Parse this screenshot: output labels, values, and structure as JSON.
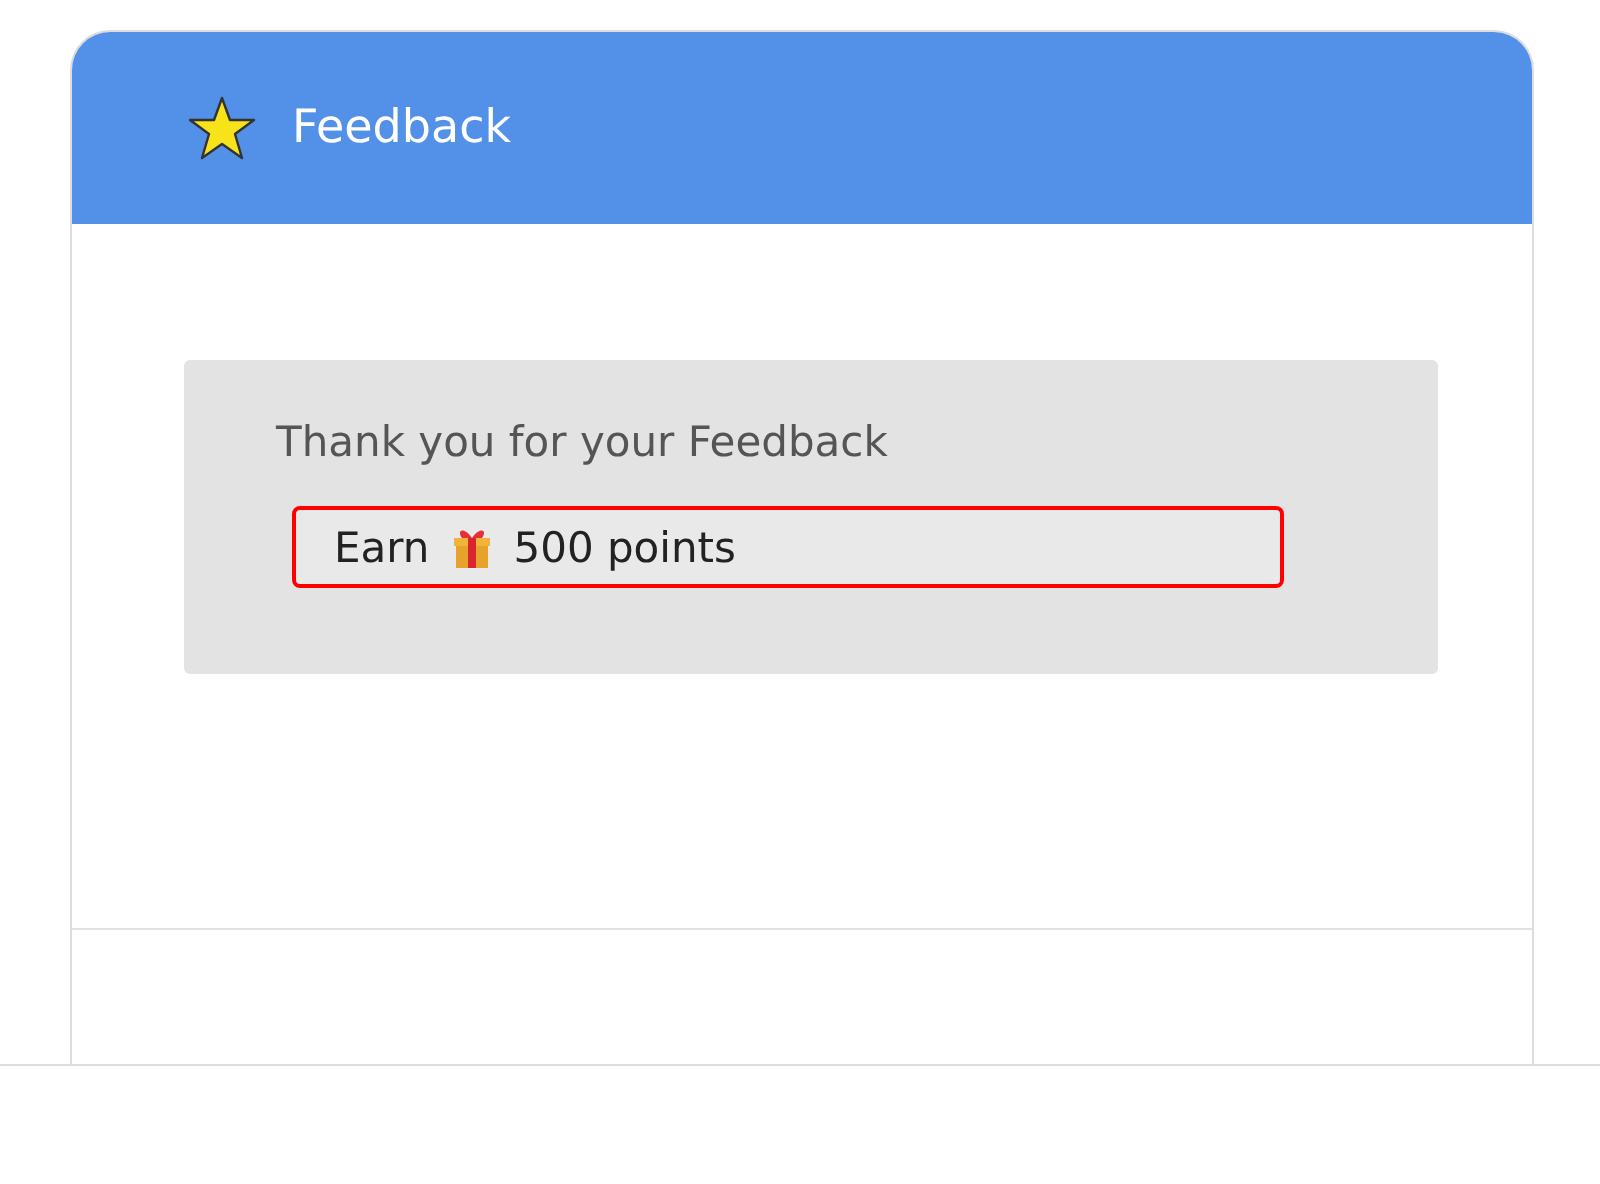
{
  "header": {
    "title": "Feedback"
  },
  "message": {
    "title": "Thank you for your Feedback",
    "reward_prefix": "Earn",
    "reward_amount": "500 points"
  }
}
